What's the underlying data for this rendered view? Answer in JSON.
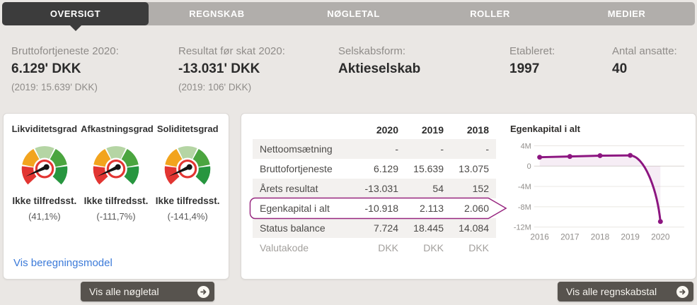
{
  "tabs": [
    {
      "label": "OVERSIGT",
      "active": true
    },
    {
      "label": "REGNSKAB",
      "active": false
    },
    {
      "label": "NØGLETAL",
      "active": false
    },
    {
      "label": "ROLLER",
      "active": false
    },
    {
      "label": "MEDIER",
      "active": false
    }
  ],
  "stats": [
    {
      "label": "Bruttofortjeneste 2020:",
      "value": "6.129' DKK",
      "sub": "(2019: 15.639' DKK)"
    },
    {
      "label": "Resultat før skat 2020:",
      "value": "-13.031' DKK",
      "sub": "(2019: 106' DKK)"
    },
    {
      "label": "Selskabsform:",
      "value": "Aktieselskab"
    },
    {
      "label": "Etableret:",
      "value": "1997"
    },
    {
      "label": "Antal ansatte:",
      "value": "40"
    }
  ],
  "ratios_card": {
    "gauges": [
      {
        "title": "Likviditetsgrad",
        "status": "Ikke tilfredsst.",
        "pct": "(41,1%)"
      },
      {
        "title": "Afkastningsgrad",
        "status": "Ikke tilfredsst.",
        "pct": "(-111,7%)"
      },
      {
        "title": "Soliditetsgrad",
        "status": "Ikke tilfredsst.",
        "pct": "(-141,4%)"
      }
    ],
    "segment_colors": [
      "#e23532",
      "#f2a41e",
      "#b5d5a4",
      "#4ba53f",
      "#27963f"
    ],
    "needle_color": "#141414",
    "ring_color": "#e23532",
    "link": "Vis beregningsmodel",
    "button": "Vis alle nøgletal"
  },
  "financials_card": {
    "table": {
      "years": [
        "2020",
        "2019",
        "2018"
      ],
      "rows": [
        {
          "label": "Nettoomsætning",
          "values": [
            "-",
            "-",
            "-"
          ]
        },
        {
          "label": "Bruttofortjeneste",
          "values": [
            "6.129",
            "15.639",
            "13.075"
          ]
        },
        {
          "label": "Årets resultat",
          "values": [
            "-13.031",
            "54",
            "152"
          ]
        },
        {
          "label": "Egenkapital i alt",
          "values": [
            "-10.918",
            "2.113",
            "2.060"
          ],
          "highlighted": true
        },
        {
          "label": "Status balance",
          "values": [
            "7.724",
            "18.445",
            "14.084"
          ]
        },
        {
          "label": "Valutakode",
          "values": [
            "DKK",
            "DKK",
            "DKK"
          ]
        }
      ]
    },
    "button": "Vis alle regnskabstal"
  },
  "chart_data": {
    "type": "line",
    "title": "Egenkapital i alt",
    "x": [
      2016,
      2017,
      2018,
      2019,
      2020
    ],
    "series": [
      {
        "name": "Egenkapital i alt",
        "values": [
          1.75,
          1.9,
          2.06,
          2.113,
          -10.918
        ]
      }
    ],
    "unit": "M DKK",
    "ylim": [
      -12,
      4
    ],
    "yticks": [
      {
        "value": 4,
        "label": "4M"
      },
      {
        "value": 0,
        "label": "0"
      },
      {
        "value": -4,
        "label": "-4M"
      },
      {
        "value": -8,
        "label": "-8M"
      },
      {
        "value": -12,
        "label": "-12M"
      }
    ],
    "grid": true,
    "legend": "none",
    "line_color": "#8c1580",
    "fill_color": "rgba(140,21,128,0.08)"
  },
  "colors": {
    "highlight": "#97257f",
    "link": "#3b7ad9",
    "button_bg": "#57534e",
    "tab_active": "#3c3c3c"
  }
}
